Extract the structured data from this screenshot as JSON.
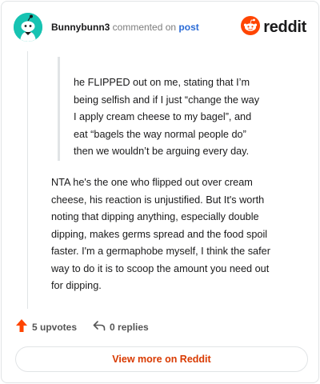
{
  "header": {
    "username": "Bunnybunn3",
    "action_text": "commented on",
    "post_link": "post",
    "brand": "reddit"
  },
  "quote": {
    "lines": [
      "he FLIPPED out on me, stating that I’m",
      "being selfish and if I just “change the way",
      "I apply cream cheese to my bagel”, and",
      "eat “bagels the way normal people do”",
      "then we wouldn’t be arguing every day."
    ]
  },
  "comment": {
    "lines": [
      "NTA he's the one who flipped out over cream",
      "cheese, his reaction is unjustified. But It's worth",
      "noting that dipping anything, especially double",
      "dipping, makes germs spread and the food spoil",
      "faster. I'm a germaphobe myself, I think the safer",
      "way to do it is to scoop the amount you need out",
      "for dipping."
    ]
  },
  "actions": {
    "upvotes": "5 upvotes",
    "replies": "0 replies",
    "upvote_icon": "upvote-arrow-icon",
    "reply_icon": "reply-arrow-icon"
  },
  "footer": {
    "view_more": "View more on Reddit"
  },
  "colors": {
    "avatar_bg": "#17c3b2",
    "brand_orange": "#ff4500",
    "upvote": "#ff4500",
    "link": "#2a6bd6",
    "view_more": "#d93a00"
  }
}
